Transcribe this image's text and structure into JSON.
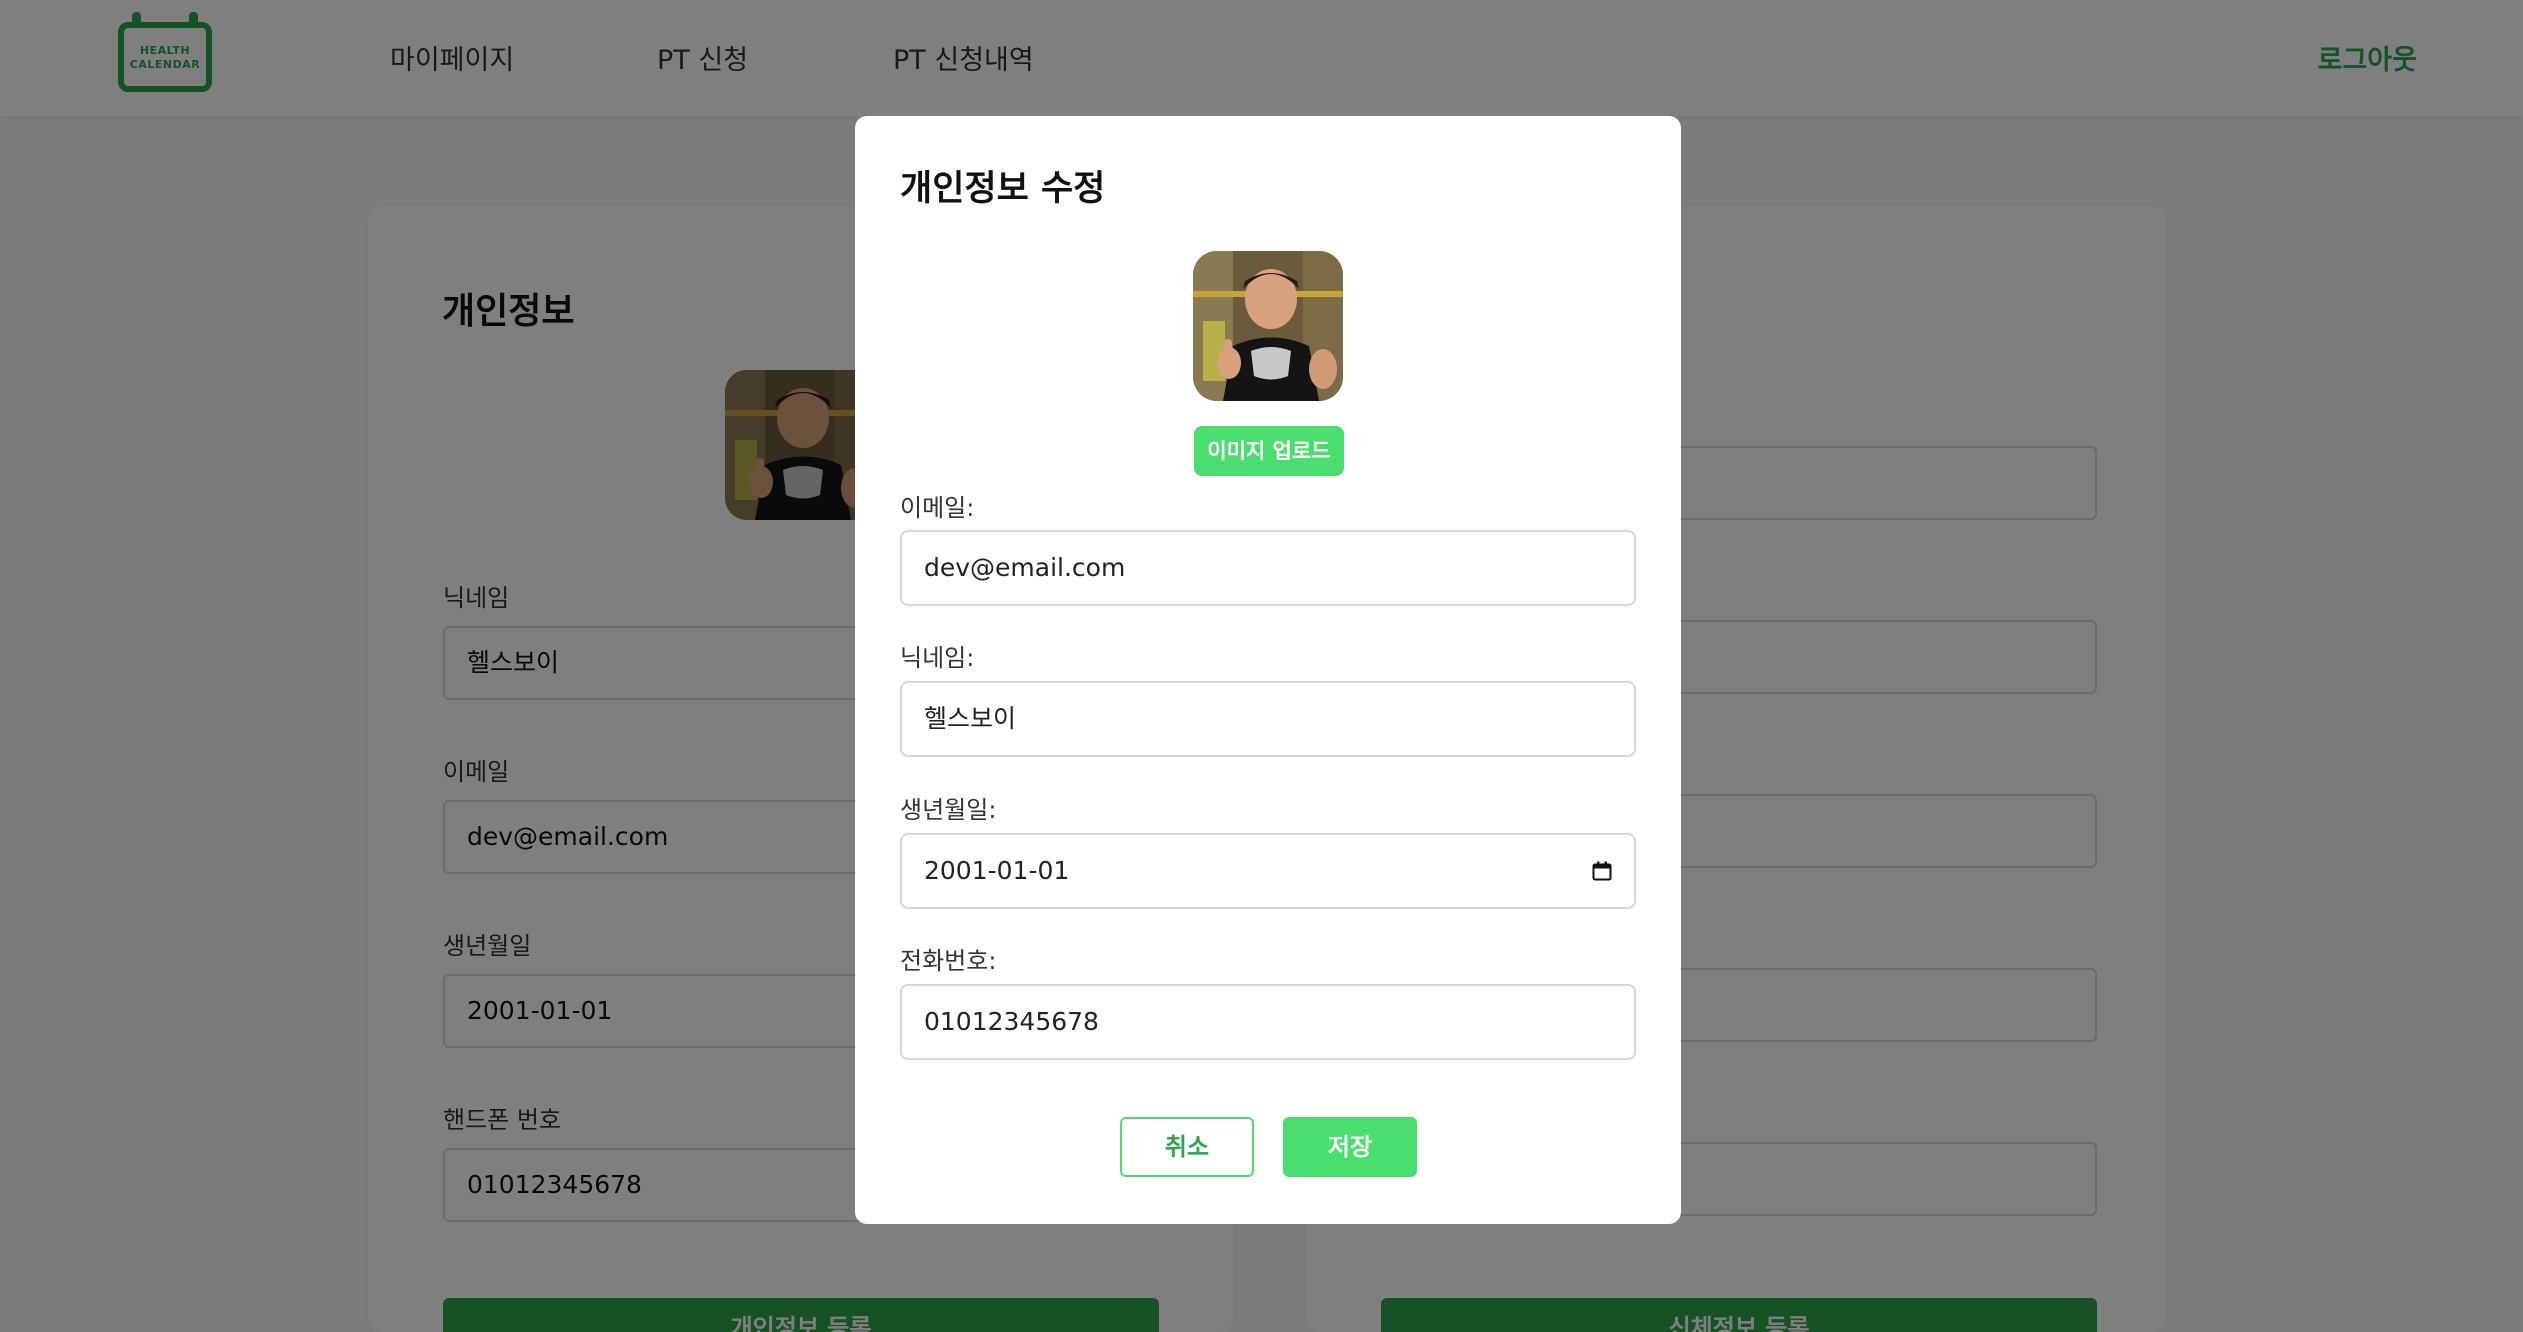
{
  "header": {
    "logo_lines": [
      "HEALTH",
      "CALENDAR"
    ],
    "nav": [
      {
        "label": "마이페이지"
      },
      {
        "label": "PT 신청"
      },
      {
        "label": "PT 신청내역"
      }
    ],
    "logout_label": "로그아웃"
  },
  "background": {
    "left_card": {
      "title": "개인정보",
      "fields": [
        {
          "label": "닉네임",
          "value": "헬스보이"
        },
        {
          "label": "이메일",
          "value": "dev@email.com"
        },
        {
          "label": "생년월일",
          "value": "2001-01-01"
        },
        {
          "label": "핸드폰 번호",
          "value": "01012345678"
        }
      ],
      "submit_label": "개인정보 등록"
    },
    "right_card": {
      "submit_label": "신체정보 등록"
    }
  },
  "modal": {
    "title": "개인정보 수정",
    "upload_label": "이미지 업로드",
    "fields": [
      {
        "label": "이메일:",
        "value": "dev@email.com"
      },
      {
        "label": "닉네임:",
        "value": "헬스보이"
      },
      {
        "label": "생년월일:",
        "value": "2001-01-01"
      },
      {
        "label": "전화번호:",
        "value": "01012345678"
      }
    ],
    "cancel_label": "취소",
    "save_label": "저장"
  },
  "colors": {
    "brand_green": "#2ea44f",
    "button_green": "#4ade6e",
    "overlay": "rgba(0,0,0,0.5)"
  },
  "icons": {
    "logo": "calendar-logo-icon",
    "date_picker": "calendar-icon"
  }
}
